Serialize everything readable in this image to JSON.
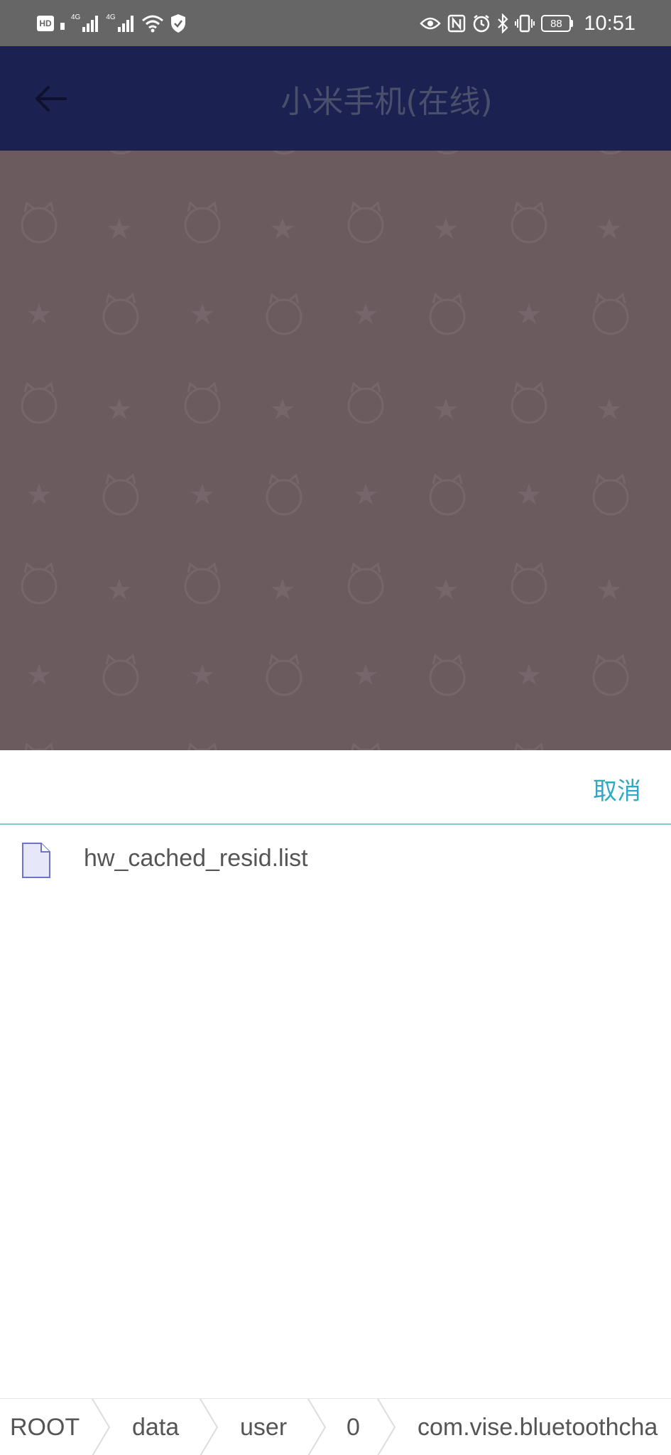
{
  "status_bar": {
    "left_icons": [
      "hd-icon",
      "signal-4g-icon",
      "signal-4g-icon",
      "wifi-icon",
      "shield-icon"
    ],
    "signal_label_1": "4G",
    "signal_label_2": "4G",
    "hd_label": "HD",
    "right_icons": [
      "eye-icon",
      "nfc-icon",
      "alarm-icon",
      "bluetooth-icon",
      "vibrate-icon",
      "battery-icon"
    ],
    "battery": "88",
    "time": "10:51"
  },
  "header": {
    "title": "小米手机(在线)",
    "back_icon": "arrow-left-icon"
  },
  "sheet": {
    "cancel_label": "取消",
    "files": [
      {
        "name": "hw_cached_resid.list",
        "icon": "file-icon"
      }
    ]
  },
  "breadcrumb": {
    "items": [
      "ROOT",
      "data",
      "user",
      "0",
      "com.vise.bluetoothcha"
    ]
  },
  "colors": {
    "status_bar_bg": "#666666",
    "header_bg": "#1b2151",
    "overlay_bg": "#6b5b5e",
    "accent": "#2fa9c4",
    "divider": "#7ecad6"
  }
}
